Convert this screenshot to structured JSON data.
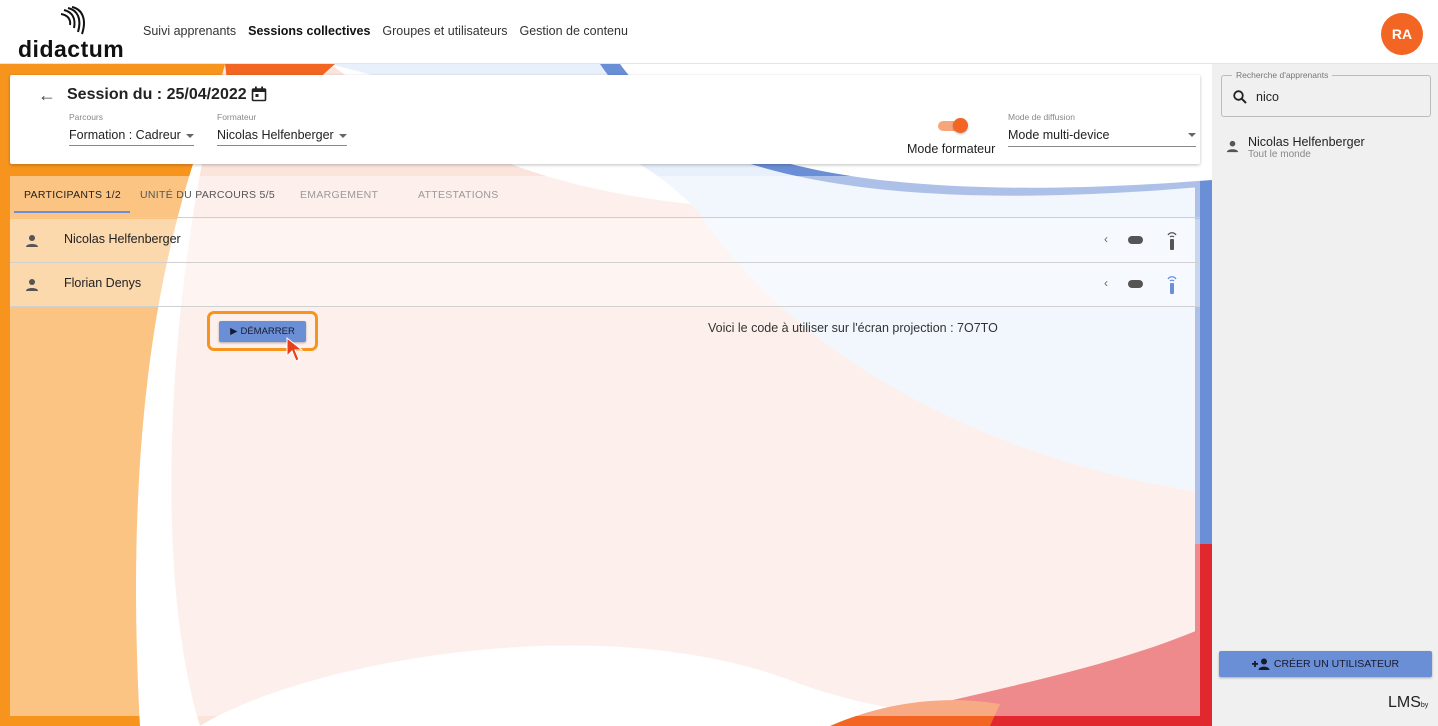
{
  "header": {
    "logo_text": "didactum",
    "nav": [
      "Suivi apprenants",
      "Sessions collectives",
      "Groupes et utilisateurs",
      "Gestion de contenu"
    ],
    "avatar_initials": "RA"
  },
  "session": {
    "title": "Session du : 25/04/2022",
    "parcours_label": "Parcours",
    "parcours_value": "Formation : Cadreur",
    "formateur_label": "Formateur",
    "formateur_value": "Nicolas Helfenberger",
    "toggle_label": "Mode formateur",
    "toggle_on": true,
    "diffusion_label": "Mode de diffusion",
    "diffusion_value": "Mode multi-device"
  },
  "tabs": [
    {
      "label": "PARTICIPANTS 1/2",
      "active": true
    },
    {
      "label": "UNITÉ DU PARCOURS 5/5",
      "active": false
    },
    {
      "label": "EMARGEMENT",
      "active": false
    },
    {
      "label": "ATTESTATIONS",
      "active": false
    }
  ],
  "participants": [
    {
      "name": "Nicolas Helfenberger"
    },
    {
      "name": "Florian Denys"
    }
  ],
  "start_button": "DÉMARRER",
  "code_text": "Voici le code à utiliser sur l'écran projection : 7O7TO",
  "side": {
    "search_label": "Recherche d'apprenants",
    "search_value": "nico",
    "results": [
      {
        "name": "Nicolas Helfenberger",
        "group": "Tout le monde"
      }
    ],
    "create_button": "CRÉER UN UTILISATEUR",
    "footer_logo": "LMS",
    "footer_logo_sub": "by"
  },
  "colors": {
    "accent_orange": "#f26522",
    "button_blue": "#6a8fd6",
    "highlight_orange": "#f7941d"
  }
}
